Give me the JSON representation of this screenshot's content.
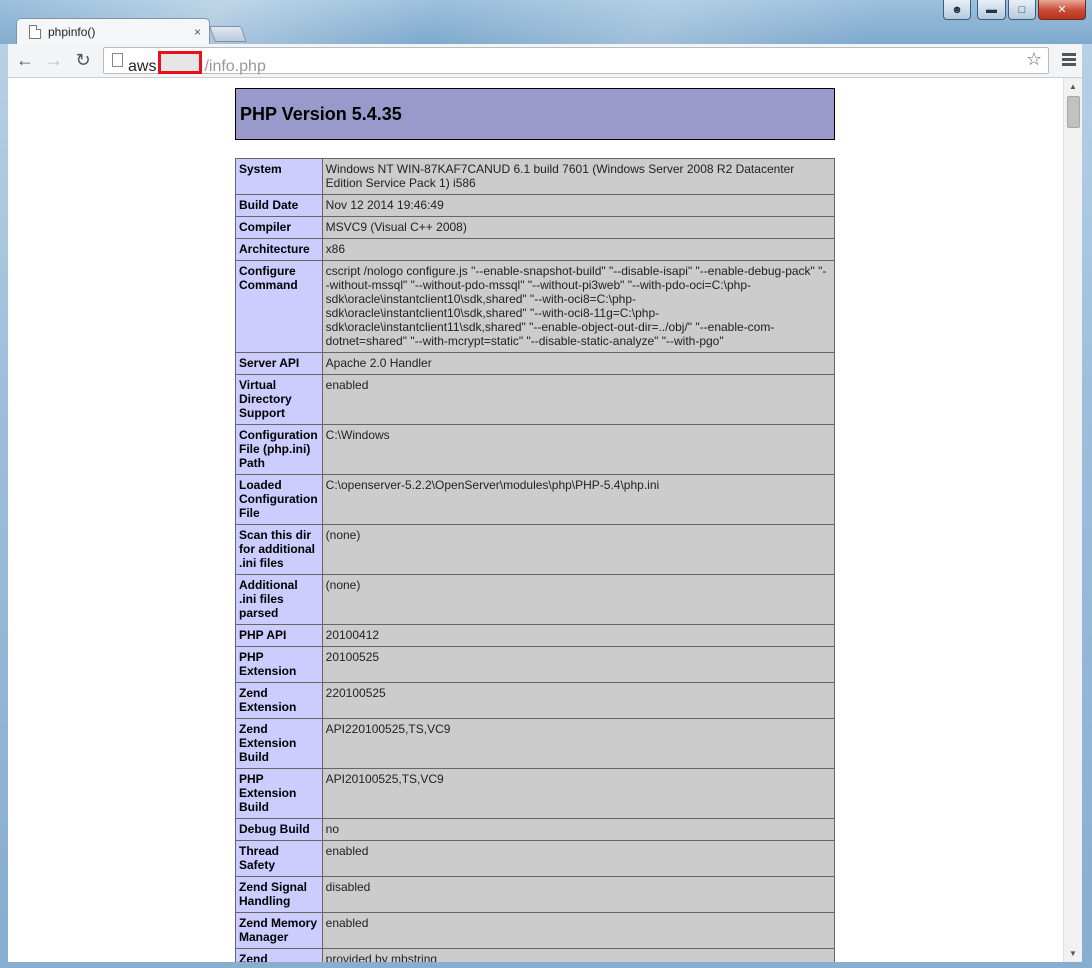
{
  "browser": {
    "tab_title": "phpinfo()",
    "tab_close": "×",
    "url_host": "aws",
    "url_path": "/info.php"
  },
  "page": {
    "header_title": "PHP Version 5.4.35",
    "rows": [
      {
        "key": "System",
        "value": "Windows NT WIN-87KAF7CANUD 6.1 build 7601 (Windows Server 2008 R2 Datacenter Edition Service Pack 1) i586"
      },
      {
        "key": "Build Date",
        "value": "Nov 12 2014 19:46:49"
      },
      {
        "key": "Compiler",
        "value": "MSVC9 (Visual C++ 2008)"
      },
      {
        "key": "Architecture",
        "value": "x86"
      },
      {
        "key": "Configure Command",
        "value": "cscript /nologo configure.js \"--enable-snapshot-build\" \"--disable-isapi\" \"--enable-debug-pack\" \"--without-mssql\" \"--without-pdo-mssql\" \"--without-pi3web\" \"--with-pdo-oci=C:\\php-sdk\\oracle\\instantclient10\\sdk,shared\" \"--with-oci8=C:\\php-sdk\\oracle\\instantclient10\\sdk,shared\" \"--with-oci8-11g=C:\\php-sdk\\oracle\\instantclient11\\sdk,shared\" \"--enable-object-out-dir=../obj/\" \"--enable-com-dotnet=shared\" \"--with-mcrypt=static\" \"--disable-static-analyze\" \"--with-pgo\""
      },
      {
        "key": "Server API",
        "value": "Apache 2.0 Handler"
      },
      {
        "key": "Virtual Directory Support",
        "value": "enabled"
      },
      {
        "key": "Configuration File (php.ini) Path",
        "value": "C:\\Windows"
      },
      {
        "key": "Loaded Configuration File",
        "value": "C:\\openserver-5.2.2\\OpenServer\\modules\\php\\PHP-5.4\\php.ini"
      },
      {
        "key": "Scan this dir for additional .ini files",
        "value": "(none)"
      },
      {
        "key": "Additional .ini files parsed",
        "value": "(none)"
      },
      {
        "key": "PHP API",
        "value": "20100412"
      },
      {
        "key": "PHP Extension",
        "value": "20100525"
      },
      {
        "key": "Zend Extension",
        "value": "220100525"
      },
      {
        "key": "Zend Extension Build",
        "value": "API220100525,TS,VC9"
      },
      {
        "key": "PHP Extension Build",
        "value": "API20100525,TS,VC9"
      },
      {
        "key": "Debug Build",
        "value": "no"
      },
      {
        "key": "Thread Safety",
        "value": "enabled"
      },
      {
        "key": "Zend Signal Handling",
        "value": "disabled"
      },
      {
        "key": "Zend Memory Manager",
        "value": "enabled"
      },
      {
        "key": "Zend Multibyte",
        "value": "provided by mbstring"
      }
    ]
  }
}
